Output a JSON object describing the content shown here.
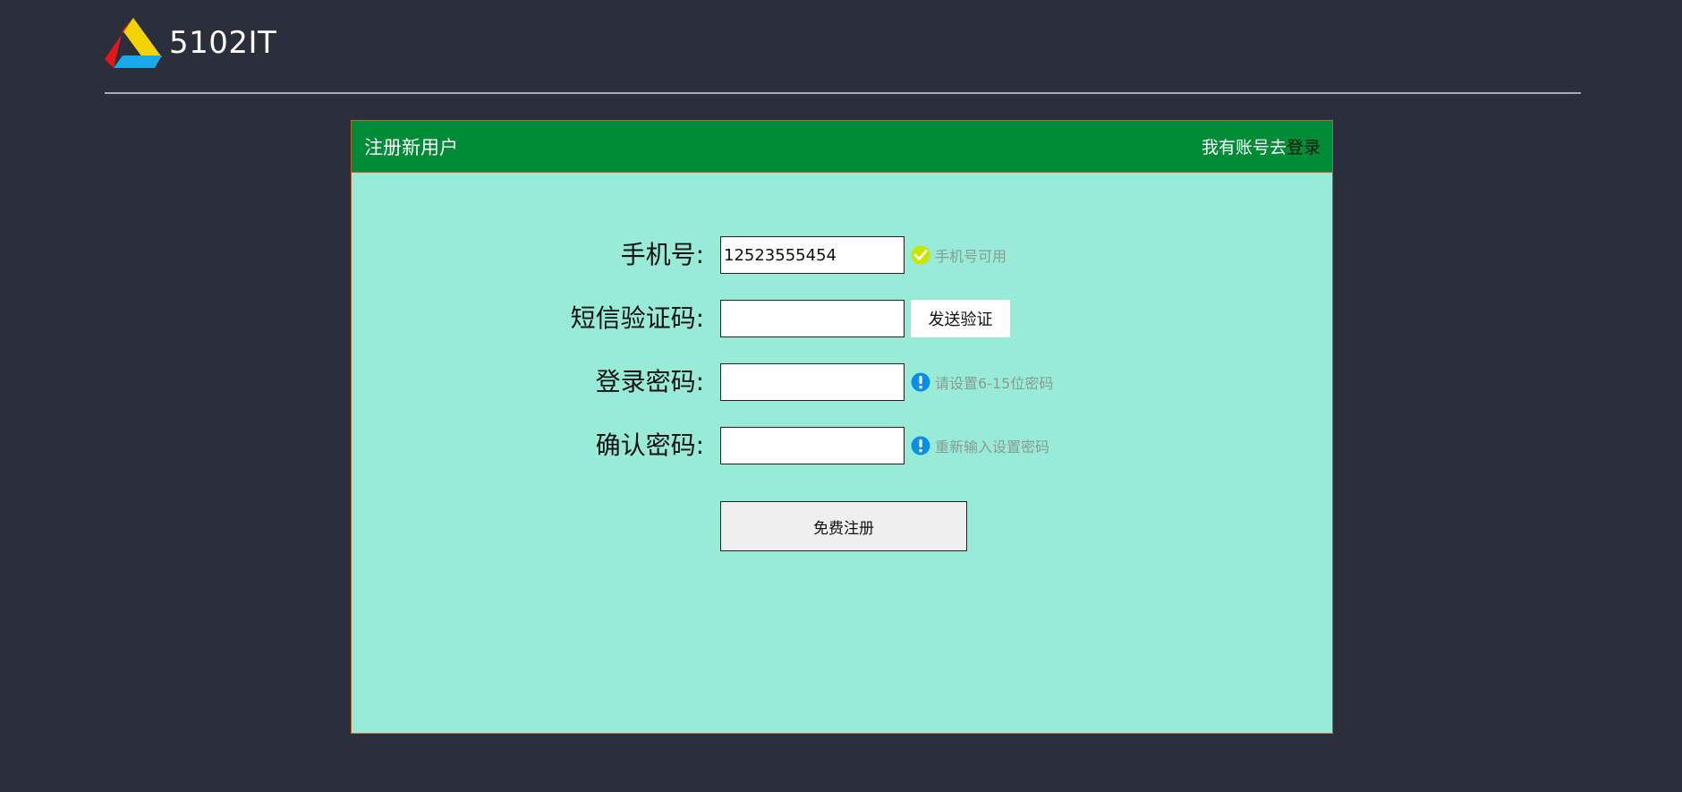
{
  "app": {
    "logo_text": "5102IT"
  },
  "panel": {
    "title": "注册新用户",
    "login_prefix": "我有账号去",
    "login_link": "登录"
  },
  "form": {
    "phone": {
      "label": "手机号:",
      "value": "12523555454",
      "hint": "手机号可用",
      "hint_icon": "check-icon"
    },
    "sms": {
      "label": "短信验证码:",
      "value": "",
      "button": "发送验证"
    },
    "password": {
      "label": "登录密码:",
      "value": "",
      "hint": "请设置6-15位密码",
      "hint_icon": "exclamation-icon"
    },
    "confirm": {
      "label": "确认密码:",
      "value": "",
      "hint": "重新输入设置密码",
      "hint_icon": "exclamation-icon"
    },
    "submit": "免费注册"
  },
  "colors": {
    "page_bg": "#2b2f3b",
    "panel_bg": "#98ecd7",
    "header_bg": "#008b37",
    "border": "#c0622f",
    "ok_icon": "#c8e600",
    "info_icon": "#0a8fe6",
    "hint_text": "#8a9a96"
  }
}
